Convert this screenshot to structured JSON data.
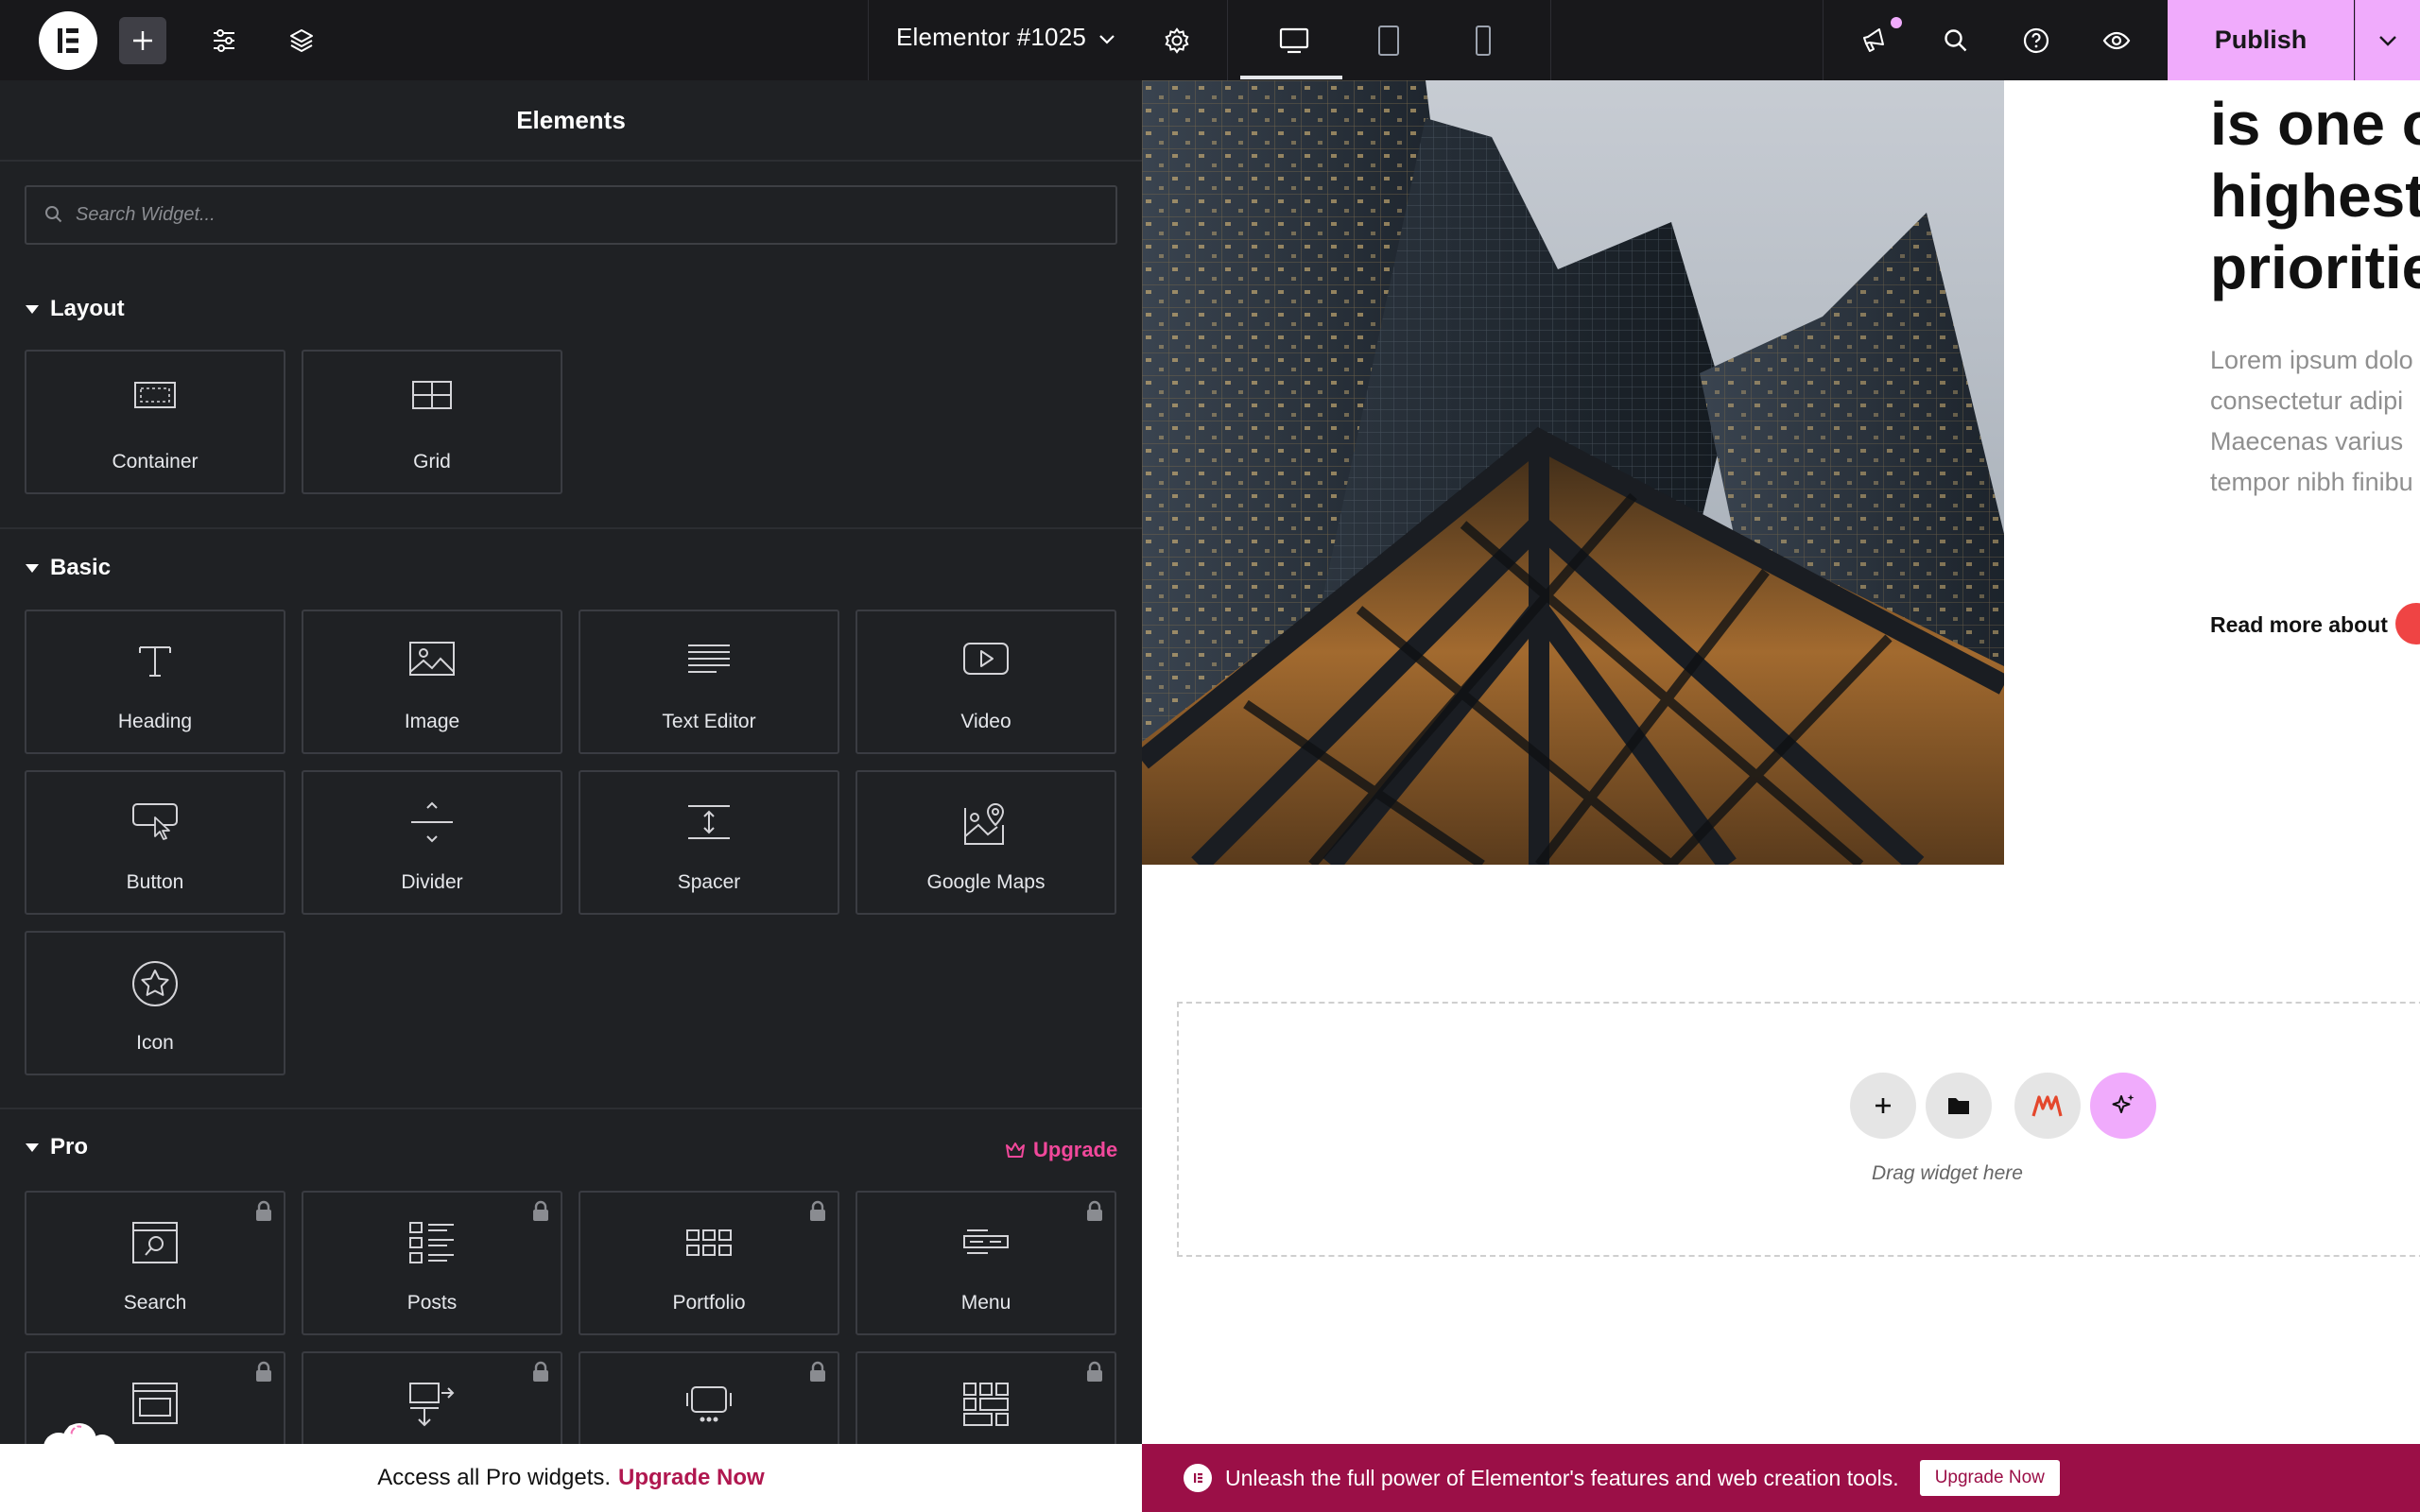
{
  "topbar": {
    "logo_icon": "elementor-logo-icon",
    "document_title": "Elementor #1025",
    "publish_label": "Publish",
    "accent_color": "#f0abfc",
    "active_device": "desktop"
  },
  "panel": {
    "title": "Elements",
    "search_placeholder": "Search Widget...",
    "sections": {
      "layout": {
        "title": "Layout",
        "widgets": [
          {
            "label": "Container",
            "icon": "container-icon"
          },
          {
            "label": "Grid",
            "icon": "grid-icon"
          }
        ]
      },
      "basic": {
        "title": "Basic",
        "widgets": [
          {
            "label": "Heading",
            "icon": "heading-icon"
          },
          {
            "label": "Image",
            "icon": "image-icon"
          },
          {
            "label": "Text Editor",
            "icon": "text-editor-icon"
          },
          {
            "label": "Video",
            "icon": "video-icon"
          },
          {
            "label": "Button",
            "icon": "button-icon"
          },
          {
            "label": "Divider",
            "icon": "divider-icon"
          },
          {
            "label": "Spacer",
            "icon": "spacer-icon"
          },
          {
            "label": "Google Maps",
            "icon": "google-maps-icon"
          },
          {
            "label": "Icon",
            "icon": "star-icon"
          }
        ]
      },
      "pro": {
        "title": "Pro",
        "upgrade_label": "Upgrade",
        "widgets": [
          {
            "label": "Search",
            "icon": "search-widget-icon",
            "locked": true
          },
          {
            "label": "Posts",
            "icon": "posts-icon",
            "locked": true
          },
          {
            "label": "Portfolio",
            "icon": "portfolio-icon",
            "locked": true
          },
          {
            "label": "Menu",
            "icon": "menu-icon",
            "locked": true
          }
        ]
      }
    },
    "notice": {
      "text": "Access all Pro widgets.",
      "link": "Upgrade Now"
    }
  },
  "canvas": {
    "heading_lines": [
      "is one o",
      "highest",
      "prioritie"
    ],
    "body_lines": [
      "Lorem ipsum dolo",
      "consectetur adipi",
      "Maecenas varius",
      "tempor nibh finibu"
    ],
    "read_more": "Read more about",
    "drop_hint": "Drag widget here"
  },
  "promo": {
    "text": "Unleash the full power of Elementor's features and web creation tools.",
    "button": "Upgrade Now"
  }
}
